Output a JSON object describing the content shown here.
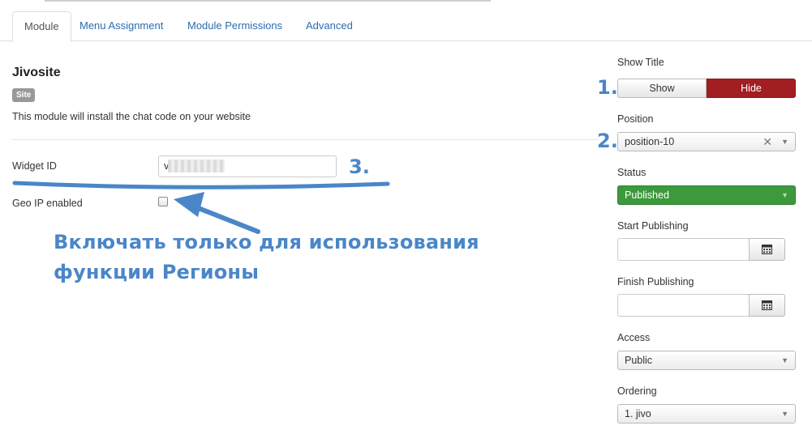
{
  "tabs": [
    {
      "label": "Module",
      "active": true
    },
    {
      "label": "Menu Assignment",
      "active": false
    },
    {
      "label": "Module Permissions",
      "active": false
    },
    {
      "label": "Advanced",
      "active": false
    }
  ],
  "module": {
    "title": "Jivosite",
    "badge": "Site",
    "description": "This module will install the chat code on your website"
  },
  "fields": {
    "widget_id_label": "Widget ID",
    "widget_id_value": "v",
    "geo_ip_label": "Geo IP enabled",
    "geo_ip_checked": false
  },
  "annotations": {
    "num1": "1.",
    "num2": "2.",
    "num3": "3.",
    "note_line1": "Включать только для использования",
    "note_line2": "функции Регионы"
  },
  "sidebar": {
    "show_title_label": "Show Title",
    "show_label": "Show",
    "hide_label": "Hide",
    "position_label": "Position",
    "position_value": "position-10",
    "status_label": "Status",
    "status_value": "Published",
    "start_publishing_label": "Start Publishing",
    "finish_publishing_label": "Finish Publishing",
    "access_label": "Access",
    "access_value": "Public",
    "ordering_label": "Ordering",
    "ordering_value": "1. jivo"
  },
  "colors": {
    "accent_blue": "#4a86c8",
    "hide_red": "#a11e22",
    "published_green": "#3c9a3c",
    "link_blue": "#2a6db0"
  }
}
